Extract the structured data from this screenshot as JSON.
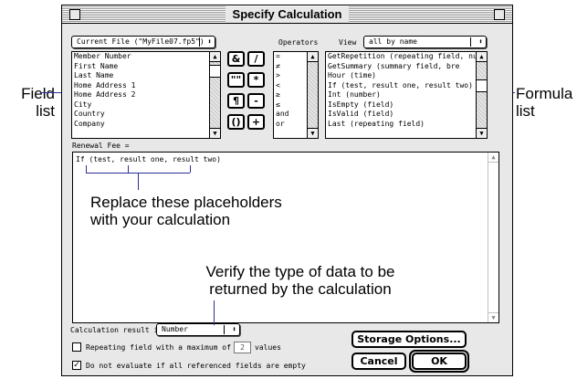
{
  "dialog": {
    "title": "Specify Calculation",
    "file_popup": "Current File (\"MyFile07.fp5\")",
    "operators_label": "Operators",
    "view_label": "View",
    "view_popup": "all by name",
    "field_list": [
      "Member Number",
      "First Name",
      "Last Name",
      "Home Address 1",
      "Home Address 2",
      "City",
      "Country",
      "Company"
    ],
    "operator_buttons": [
      "&",
      "/",
      "\"\"",
      "*",
      "¶",
      "-",
      "()",
      "+"
    ],
    "operators_list": [
      "=",
      "≠",
      ">",
      "<",
      "≥",
      "≤",
      "and",
      "or"
    ],
    "formula_list": [
      "GetRepetition (repeating field, nu",
      "GetSummary (summary field, bre",
      "Hour (time)",
      "If (test, result one, result two)",
      "Int (number)",
      "IsEmpty (field)",
      "IsValid (field)",
      "Last (repeating field)"
    ],
    "field_name_label": "Renewal Fee =",
    "formula_text": "If (test, result one, result two)",
    "result_label": "Calculation result is",
    "result_popup": "Number",
    "repeating_label": "Repeating field with a maximum of",
    "repeating_value": "2",
    "values_label": "values",
    "repeating_checked": false,
    "no_evaluate_label": "Do not evaluate if all referenced fields are empty",
    "no_evaluate_checked": true,
    "storage_button": "Storage Options...",
    "cancel_button": "Cancel",
    "ok_button": "OK"
  },
  "callouts": {
    "field_list": "Field list",
    "formula_list": "Formula list",
    "placeholders": "Replace these placeholders with your calculation",
    "result_type": "Verify the type of data to be returned by the calculation"
  },
  "icons": {
    "check_glyph": "✓",
    "up_arrow": "▲",
    "down_arrow": "▼",
    "updown": "⬍"
  },
  "colors": {
    "callout_line": "#2b2f9a"
  }
}
